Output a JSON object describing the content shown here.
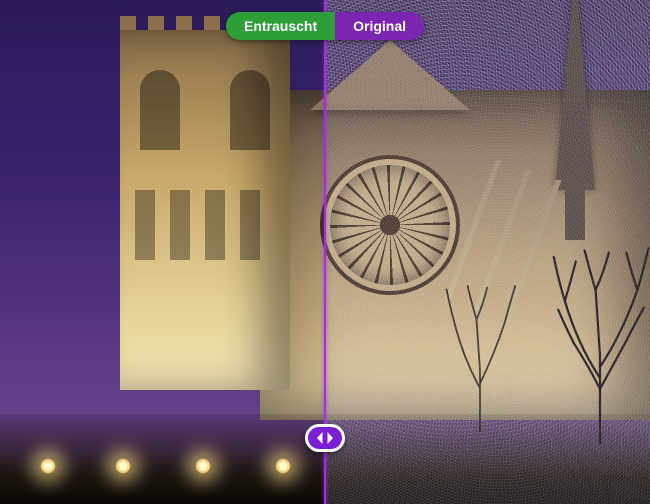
{
  "comparison": {
    "left_label": "Entrauscht",
    "right_label": "Original",
    "slider_position_percent": 50,
    "colors": {
      "left_badge_bg": "#2e9e3a",
      "right_badge_bg": "#7b26b3",
      "divider": "#a030e0",
      "knob_bg": "#7b1fd6",
      "knob_border": "#ffffff"
    },
    "icons": {
      "knob_left": "chevron-left-icon",
      "knob_right": "chevron-right-icon"
    }
  }
}
